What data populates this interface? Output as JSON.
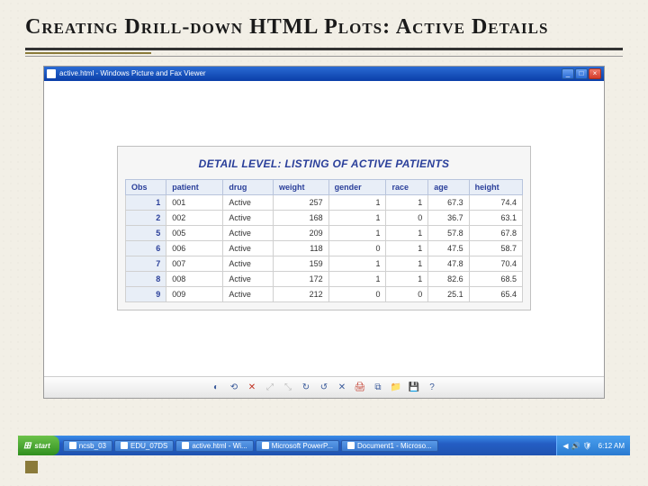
{
  "slide": {
    "title": "Creating Drill-down HTML Plots: Active Details"
  },
  "window": {
    "title": "active.html - Windows Picture and Fax Viewer",
    "min": "_",
    "max": "□",
    "close": "×"
  },
  "report": {
    "title": "DETAIL LEVEL: LISTING OF ACTIVE PATIENTS",
    "columns": [
      "Obs",
      "patient",
      "drug",
      "weight",
      "gender",
      "race",
      "age",
      "height"
    ],
    "rows": [
      {
        "obs": "1",
        "patient": "001",
        "drug": "Active",
        "weight": "257",
        "gender": "1",
        "race": "1",
        "age": "67.3",
        "height": "74.4"
      },
      {
        "obs": "2",
        "patient": "002",
        "drug": "Active",
        "weight": "168",
        "gender": "1",
        "race": "0",
        "age": "36.7",
        "height": "63.1"
      },
      {
        "obs": "5",
        "patient": "005",
        "drug": "Active",
        "weight": "209",
        "gender": "1",
        "race": "1",
        "age": "57.8",
        "height": "67.8"
      },
      {
        "obs": "6",
        "patient": "006",
        "drug": "Active",
        "weight": "118",
        "gender": "0",
        "race": "1",
        "age": "47.5",
        "height": "58.7"
      },
      {
        "obs": "7",
        "patient": "007",
        "drug": "Active",
        "weight": "159",
        "gender": "1",
        "race": "1",
        "age": "47.8",
        "height": "70.4"
      },
      {
        "obs": "8",
        "patient": "008",
        "drug": "Active",
        "weight": "172",
        "gender": "1",
        "race": "1",
        "age": "82.6",
        "height": "68.5"
      },
      {
        "obs": "9",
        "patient": "009",
        "drug": "Active",
        "weight": "212",
        "gender": "0",
        "race": "0",
        "age": "25.1",
        "height": "65.4"
      }
    ]
  },
  "toolbar_icons": [
    "◐",
    "⟲",
    "✕",
    "⤢",
    "⤡",
    "↻",
    "↺",
    "✕",
    "🖨",
    "⧉",
    "📁",
    "💾",
    "?"
  ],
  "taskbar": {
    "start": "start",
    "items": [
      "ncsb_03",
      "EDU_07DS",
      "active.html - Wi...",
      "Microsoft PowerP...",
      "Document1 - Microso..."
    ],
    "tray_icons": [
      "◀",
      "🔊",
      "🛡"
    ],
    "time": "6:12 AM"
  },
  "chart_data": {
    "type": "table",
    "title": "DETAIL LEVEL: LISTING OF ACTIVE PATIENTS",
    "columns": [
      "Obs",
      "patient",
      "drug",
      "weight",
      "gender",
      "race",
      "age",
      "height"
    ],
    "rows": [
      [
        1,
        "001",
        "Active",
        257,
        1,
        1,
        67.3,
        74.4
      ],
      [
        2,
        "002",
        "Active",
        168,
        1,
        0,
        36.7,
        63.1
      ],
      [
        5,
        "005",
        "Active",
        209,
        1,
        1,
        57.8,
        67.8
      ],
      [
        6,
        "006",
        "Active",
        118,
        0,
        1,
        47.5,
        58.7
      ],
      [
        7,
        "007",
        "Active",
        159,
        1,
        1,
        47.8,
        70.4
      ],
      [
        8,
        "008",
        "Active",
        172,
        1,
        1,
        82.6,
        68.5
      ],
      [
        9,
        "009",
        "Active",
        212,
        0,
        0,
        25.1,
        65.4
      ]
    ]
  }
}
